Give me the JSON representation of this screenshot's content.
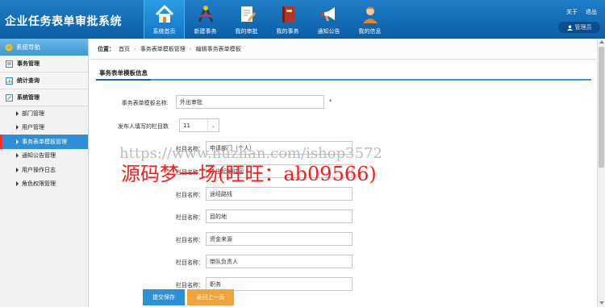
{
  "app": {
    "title": "企业任务表单审批系统"
  },
  "nav": [
    {
      "label": "系统首页",
      "icon": "home-icon",
      "active": true
    },
    {
      "label": "新建事务",
      "icon": "compass-icon",
      "active": false
    },
    {
      "label": "我的审批",
      "icon": "edit-document-icon",
      "active": false
    },
    {
      "label": "我的事务",
      "icon": "book-icon",
      "active": false
    },
    {
      "label": "通知公告",
      "icon": "megaphone-icon",
      "active": false
    },
    {
      "label": "我的信息",
      "icon": "user-icon",
      "active": false
    }
  ],
  "top_links": {
    "about": "关于",
    "logout": "退出",
    "user": "管理员"
  },
  "sidebar": {
    "header": "系统导航",
    "sections": [
      {
        "label": "事务管理"
      },
      {
        "label": "统计查询"
      },
      {
        "label": "系统管理"
      }
    ],
    "items": [
      {
        "label": "部门管理"
      },
      {
        "label": "用户管理"
      },
      {
        "label": "事务表单模板管理"
      },
      {
        "label": "通知公告管理"
      },
      {
        "label": "用户操作日志"
      },
      {
        "label": "角色权限管理"
      }
    ]
  },
  "breadcrumb": {
    "prefix": "位置：",
    "items": [
      "首页",
      "事务表单模板管理",
      "编辑事务表单模板"
    ]
  },
  "panel": {
    "title": "事务表单模板信息"
  },
  "form": {
    "name_label": "事务表单模板名称:",
    "name_value": "外出审批",
    "required_mark": "*",
    "count_label": "发布人填写的栏目数",
    "count_value": "11",
    "field_label": "栏目名称：",
    "fields": [
      "申请部门（个人）",
      "外出起始时间",
      "途经路线",
      "目的地",
      "资金来源",
      "带队负责人",
      "职务"
    ]
  },
  "buttons": {
    "save": "提交保存",
    "back": "返回上一页"
  },
  "watermark": {
    "url": "https://www.huzhan.com/ishop3572",
    "text": "源码梦一场(旺旺：ab09566)"
  },
  "colors": {
    "header_blue": "#0c5ea6",
    "accent_blue": "#2d8fd5",
    "back_orange": "#f0a43b",
    "watermark_red": "#ff1a1a"
  }
}
